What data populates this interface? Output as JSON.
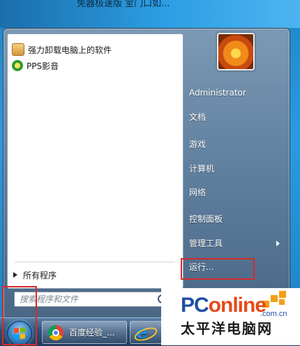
{
  "desktop": {
    "caption": "免器极速版    室门口如..."
  },
  "start_menu": {
    "programs": [
      {
        "label": "强力卸载电脑上的软件",
        "icon": "uninstall-icon"
      },
      {
        "label": "PPS影音",
        "icon": "pps-icon"
      }
    ],
    "all_programs_label": "所有程序",
    "search_placeholder": "搜索程序和文件",
    "user_name": "Administrator",
    "right_items": [
      {
        "label": "文档"
      },
      {
        "label": "游戏"
      },
      {
        "label": "计算机"
      },
      {
        "label": "网络"
      },
      {
        "label": "控制面板"
      },
      {
        "label": "管理工具",
        "has_submenu": true
      },
      {
        "label": "运行..."
      }
    ]
  },
  "taskbar": {
    "buttons": [
      {
        "label": "百度经验_...",
        "icon": "chrome-icon"
      },
      {
        "label": "",
        "icon": "ie-icon"
      }
    ]
  },
  "watermark": {
    "brand_left": "PC",
    "brand_right": "online",
    "domain": ".com.cn",
    "cn_text": "太平洋电脑网"
  },
  "colors": {
    "highlight_red": "#d62a2a",
    "brand_blue": "#1e4fa3",
    "brand_orange": "#f3a014"
  }
}
